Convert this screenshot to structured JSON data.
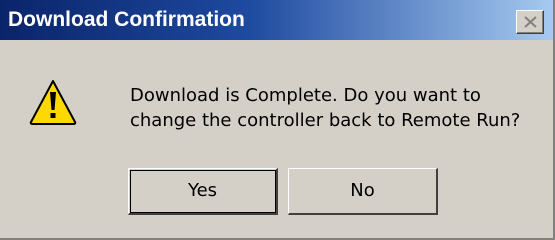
{
  "window": {
    "title": "Download Confirmation",
    "close_label": "Close"
  },
  "dialog": {
    "icon": "warning-icon",
    "message_line1": "Download is Complete. Do you want to",
    "message_line2": "change the controller back to Remote Run?"
  },
  "buttons": {
    "yes_label": "Yes",
    "no_label": "No"
  },
  "colors": {
    "titlebar_start": "#0a246a",
    "titlebar_end": "#a6caf0",
    "dialog_bg": "#d4d0c8",
    "warning_yellow": "#ffd800"
  }
}
